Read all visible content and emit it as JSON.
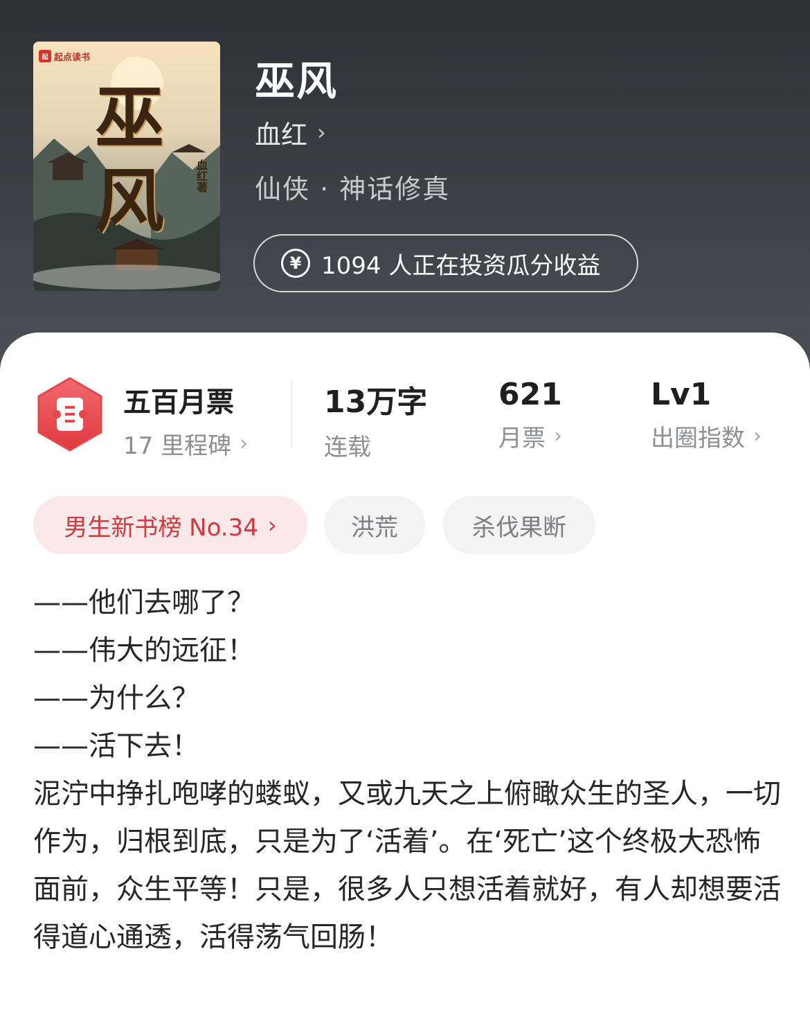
{
  "book": {
    "cover_logo": "起点读书",
    "cover_title": "巫风",
    "cover_author": "血红著",
    "title": "巫风",
    "author": "血红",
    "genre": "仙侠 · 神话修真",
    "invest_text": "1094 人正在投资瓜分收益"
  },
  "stats": {
    "ticket_title": "五百月票",
    "ticket_sub": "17 里程碑",
    "words_value": "13万字",
    "words_label": "连载",
    "votes_value": "621",
    "votes_label": "月票",
    "level_value": "Lv1",
    "level_label": "出圈指数"
  },
  "tags": {
    "rank": "男生新书榜 No.34",
    "tag1": "洪荒",
    "tag2": "杀伐果断"
  },
  "description": {
    "line1": "——他们去哪了？",
    "line2": "——伟大的远征！",
    "line3": "——为什么？",
    "line4": "——活下去！",
    "paragraph": "泥泞中挣扎咆哮的蝼蚁，又或九天之上俯瞰众生的圣人，一切作为，归根到底，只是为了‘活着’。在‘死亡’这个终极大恐怖面前，众生平等！只是，很多人只想活着就好，有人却想要活得道心通透，活得荡气回肠！"
  },
  "icons": {
    "author_chevron": "chevron-right-icon",
    "yen": "yen-coin-icon",
    "ticket": "ticket-icon"
  },
  "colors": {
    "header_bg": "#3a3d42",
    "accent_red": "#e2464c",
    "rank_tag_bg": "#fbe9ea"
  }
}
